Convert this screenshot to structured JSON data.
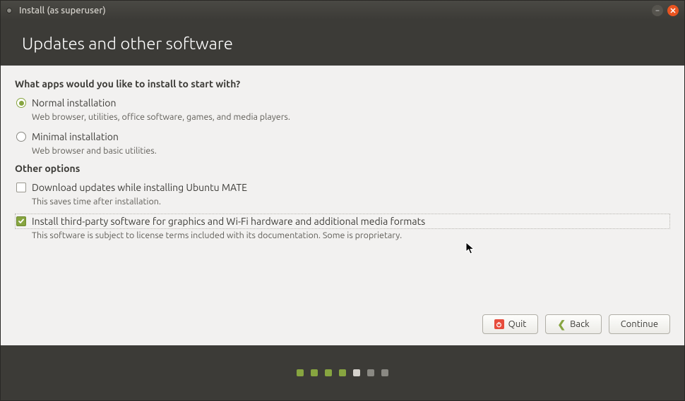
{
  "window": {
    "title": "Install (as superuser)"
  },
  "header": {
    "title": "Updates and other software"
  },
  "main": {
    "question": "What apps would you like to install to start with?",
    "options": [
      {
        "label": "Normal installation",
        "desc": "Web browser, utilities, office software, games, and media players.",
        "selected": true
      },
      {
        "label": "Minimal installation",
        "desc": "Web browser and basic utilities.",
        "selected": false
      }
    ],
    "other_title": "Other options",
    "checkboxes": [
      {
        "label": "Download updates while installing Ubuntu MATE",
        "desc": "This saves time after installation.",
        "checked": false
      },
      {
        "label": "Install third-party software for graphics and Wi-Fi hardware and additional media formats",
        "desc": "This software is subject to license terms included with its documentation. Some is proprietary.",
        "checked": true
      }
    ]
  },
  "buttons": {
    "quit": "Quit",
    "back": "Back",
    "continue": "Continue"
  },
  "progress": {
    "total": 7,
    "done": 4,
    "current": 5
  }
}
